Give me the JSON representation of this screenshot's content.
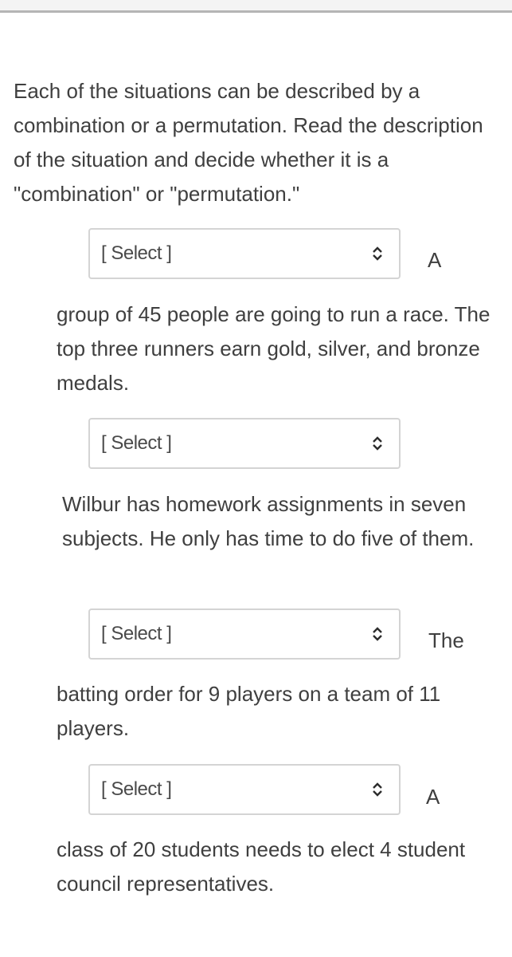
{
  "instructions": "Each of the situations can be described by a combination or a permutation. Read the description of the situation and decide whether it is a \"combination\" or \"permutation.\"",
  "questions": [
    {
      "select": {
        "value": "[ Select ]",
        "icon": "up-down-chevron-icon"
      },
      "lead_word": "A",
      "text": "group of 45 people are going to run a race. The top three runners earn gold, silver, and bronze medals."
    },
    {
      "select": {
        "value": "[ Select ]",
        "icon": "up-down-chevron-icon"
      },
      "lead_word": "",
      "text": "Wilbur has homework assignments in seven subjects. He only has time to do five of them."
    },
    {
      "select": {
        "value": "[ Select ]",
        "icon": "up-down-chevron-icon"
      },
      "lead_word": "The",
      "text": "batting order for 9 players on a team of 11 players."
    },
    {
      "select": {
        "value": "[ Select ]",
        "icon": "up-down-chevron-icon"
      },
      "lead_word": "A",
      "text": "class of 20 students needs to elect 4 student council representatives."
    }
  ]
}
